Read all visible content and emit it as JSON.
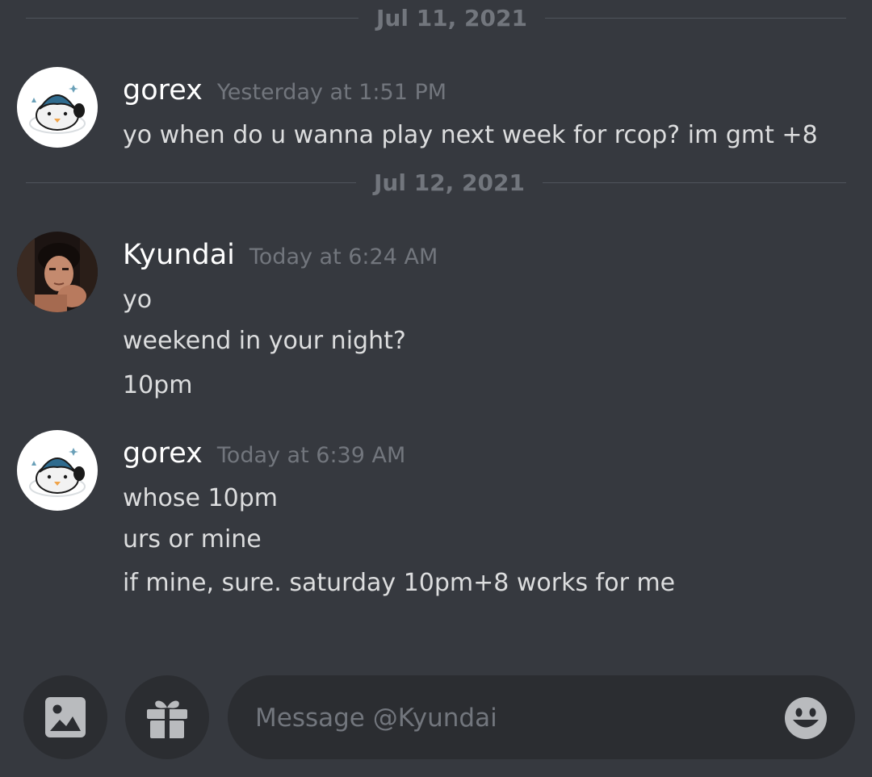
{
  "dividers": [
    {
      "label": "Jul 11, 2021"
    },
    {
      "label": "Jul 12, 2021"
    }
  ],
  "messages": [
    {
      "author": "gorex",
      "timestamp": "Yesterday at 1:51 PM",
      "avatar": "penguin-avatar",
      "lines": [
        "yo when do u wanna play next week for rcop? im gmt +8"
      ]
    },
    {
      "author": "Kyundai",
      "timestamp": "Today at 6:24 AM",
      "avatar": "photo-avatar",
      "lines": [
        "yo",
        "weekend in your night?",
        "10pm"
      ]
    },
    {
      "author": "gorex",
      "timestamp": "Today at 6:39 AM",
      "avatar": "penguin-avatar",
      "lines": [
        "whose 10pm",
        "urs or mine",
        "if mine, sure. saturday 10pm+8 works for me"
      ]
    }
  ],
  "composer": {
    "placeholder": "Message @Kyundai",
    "value": ""
  },
  "icons": {
    "attach": "image-icon",
    "gift": "gift-icon",
    "emoji": "emoji-icon"
  },
  "colors": {
    "background": "#36393f",
    "input_background": "#2b2d31",
    "username": "#ffffff",
    "text": "#dcddde",
    "muted": "#72767d",
    "icon": "#b9bbbe"
  }
}
